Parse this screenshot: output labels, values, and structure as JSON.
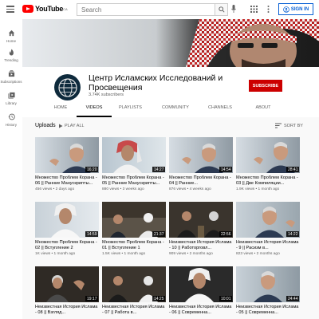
{
  "topbar": {
    "logo_text": "YouTube",
    "logo_country": "CA",
    "search_placeholder": "Search",
    "signin_label": "SIGN IN"
  },
  "sidebar": {
    "items": [
      {
        "label": "Home",
        "icon": "home-icon"
      },
      {
        "label": "Trending",
        "icon": "fire-icon"
      },
      {
        "label": "Subscriptions",
        "icon": "subscriptions-icon"
      },
      {
        "label": "Library",
        "icon": "library-icon"
      },
      {
        "label": "History",
        "icon": "history-icon"
      }
    ]
  },
  "channel": {
    "title": "Центр Исламских Исследований и Просвещения",
    "subscribers": "3.74K subscribers",
    "subscribe_label": "SUBSCRIBE"
  },
  "tabs": [
    {
      "label": "HOME",
      "active": false
    },
    {
      "label": "VIDEOS",
      "active": true
    },
    {
      "label": "PLAYLISTS",
      "active": false
    },
    {
      "label": "COMMUNITY",
      "active": false
    },
    {
      "label": "CHANNELS",
      "active": false
    },
    {
      "label": "ABOUT",
      "active": false
    }
  ],
  "section": {
    "title": "Uploads",
    "play_all": "PLAY ALL",
    "sort_by": "SORT BY"
  },
  "videos": [
    {
      "title": "Множество Проблем Корана - 06 || Ранние Манускрипты...",
      "meta": "456 views • 2 days ago",
      "duration": "16:20"
    },
    {
      "title": "Множество Проблем Корана - 05 || Ранние Манускрипты...",
      "meta": "880 views • 3 weeks ago",
      "duration": "14:27"
    },
    {
      "title": "Множество Проблем Корана - 04 || Ранние...",
      "meta": "876 views • 4 weeks ago",
      "duration": "14:54"
    },
    {
      "title": "Множество Проблем Корана - 03 || Две Компиляции...",
      "meta": "1.9K views • 1 month ago",
      "duration": "28:41"
    },
    {
      "title": "Множество Проблем Корана - 02 || Вступление 2",
      "meta": "1K views • 1 month ago",
      "duration": "14:59"
    },
    {
      "title": "Множество Проблем Корана - 01 || Вступление 1",
      "meta": "1.5K views • 1 month ago",
      "duration": "21:37"
    },
    {
      "title": "Неизвестная История Ислама - 10 || Работорговл...",
      "meta": "909 views • 2 months ago",
      "duration": "22:56"
    },
    {
      "title": "Неизвестная История Ислама - 9 || Расизм в...",
      "meta": "823 views • 2 months ago",
      "duration": "14:22"
    },
    {
      "title": "Неизвестная История Ислама - 08 || Взгляд...",
      "meta": "",
      "duration": "19:17"
    },
    {
      "title": "Неизвестная История Ислама - 07 || Работа в...",
      "meta": "",
      "duration": "14:25"
    },
    {
      "title": "Неизвестная История Ислама - 06 || Современна...",
      "meta": "",
      "duration": "10:01"
    },
    {
      "title": "Неизвестная История Ислама - 05 || Современна...",
      "meta": "",
      "duration": "24:44"
    }
  ],
  "colors": {
    "brand_red": "#ff0000",
    "subscribe_red": "#cc0000",
    "link_blue": "#065fd4"
  }
}
